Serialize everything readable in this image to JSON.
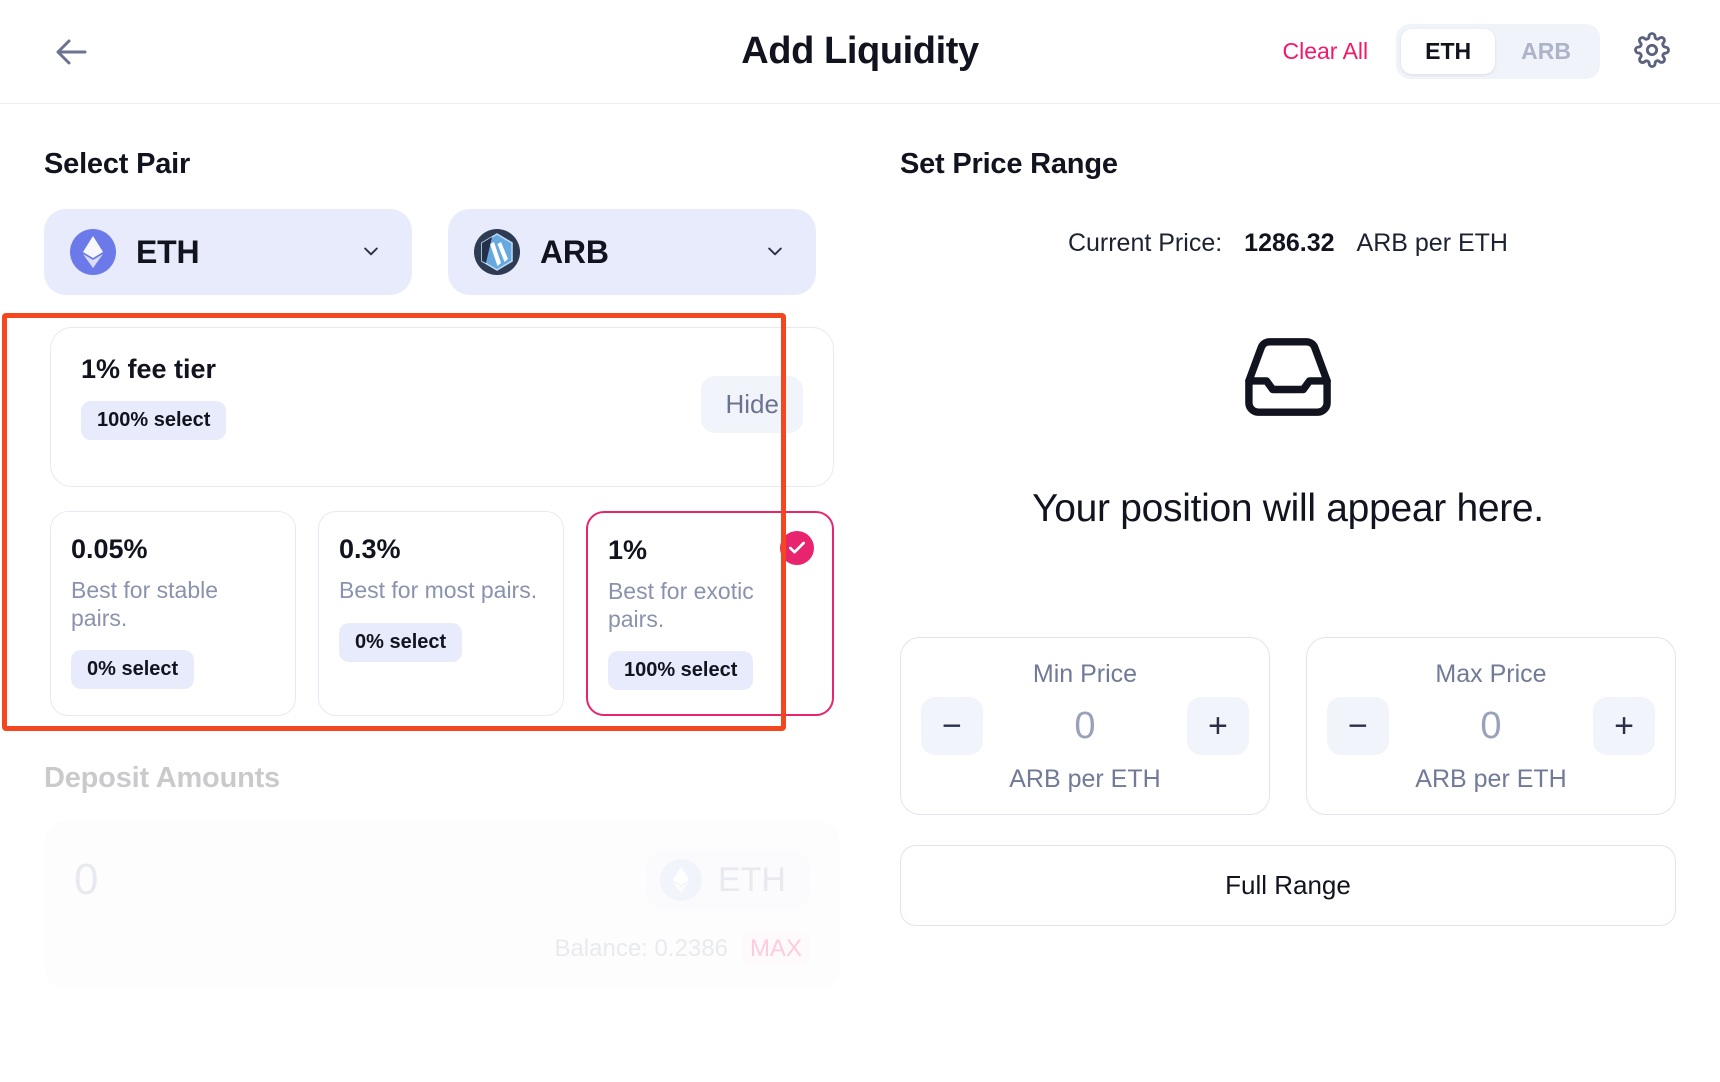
{
  "header": {
    "back_icon": "arrow-left-icon",
    "title": "Add Liquidity",
    "clear_all": "Clear All",
    "toggle": {
      "options": [
        "ETH",
        "ARB"
      ],
      "selected": "ETH"
    },
    "settings_icon": "gear-icon"
  },
  "select_pair": {
    "title": "Select Pair",
    "tokens": [
      {
        "symbol": "ETH",
        "logo": "ethereum-logo-icon"
      },
      {
        "symbol": "ARB",
        "logo": "arbitrum-logo-icon"
      }
    ],
    "chevron_icon": "chevron-down-icon"
  },
  "fee_tier": {
    "summary_title": "1% fee tier",
    "summary_pill": "100% select",
    "hide_label": "Hide",
    "cards": [
      {
        "pct": "0.05%",
        "desc": "Best for stable pairs.",
        "pill": "0% select",
        "selected": false
      },
      {
        "pct": "0.3%",
        "desc": "Best for most pairs.",
        "pill": "0% select",
        "selected": false
      },
      {
        "pct": "1%",
        "desc": "Best for exotic pairs.",
        "pill": "100% select",
        "selected": true
      }
    ],
    "check_icon": "check-icon",
    "highlight_color": "#f4471f",
    "accent_color": "#e8246f"
  },
  "deposit": {
    "title": "Deposit Amounts",
    "amount": "0",
    "token": "ETH",
    "token_logo": "ethereum-logo-icon",
    "balance_label": "Balance: 0.2386",
    "max_label": "MAX"
  },
  "price_range": {
    "title": "Set Price Range",
    "current_price_label": "Current Price:",
    "current_price_value": "1286.32",
    "current_price_unit": "ARB per ETH",
    "empty_icon": "inbox-icon",
    "empty_text": "Your position will appear here.",
    "min": {
      "label": "Min Price",
      "value": "0",
      "unit": "ARB per ETH",
      "minus": "−",
      "plus": "+"
    },
    "max": {
      "label": "Max Price",
      "value": "0",
      "unit": "ARB per ETH",
      "minus": "−",
      "plus": "+"
    },
    "full_range_label": "Full Range"
  }
}
